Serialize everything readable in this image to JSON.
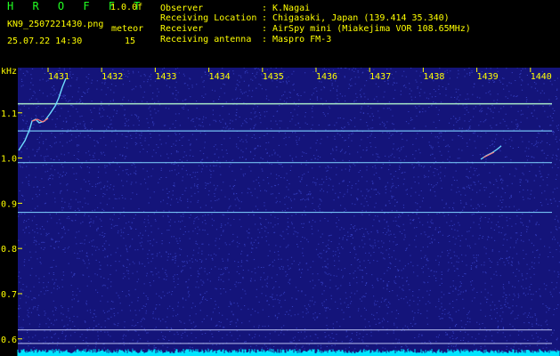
{
  "header": {
    "app_title": "H R O F F T",
    "version": "1.0.0f",
    "filename": "KN9_2507221430.png",
    "meteo_label": "meteor",
    "timestamp": "25.07.22 14:30",
    "meteo_count": "15"
  },
  "info": [
    {
      "label": "Observer",
      "value": "K.Nagai"
    },
    {
      "label": "Receiving Location",
      "value": "Chigasaki, Japan (139.414 35.340)"
    },
    {
      "label": "Receiver",
      "value": "AirSpy mini (Miakejima VOR 108.65MHz)"
    },
    {
      "label": "Receiving antenna",
      "value": "Maspro FM-3"
    }
  ],
  "spectrogram": {
    "unit_label": "kHz",
    "time_labels": [
      "1431",
      "1432",
      "1433",
      "1434",
      "1435",
      "1436",
      "1437",
      "1438",
      "1439",
      "1440"
    ],
    "freq_labels": [
      "1.1",
      "1.0",
      "0.9",
      "0.8",
      "0.7",
      "0.6"
    ],
    "freq_values": [
      1.1,
      1.0,
      0.9,
      0.8,
      0.7,
      0.6
    ],
    "carriers_khz": [
      1.12,
      1.06,
      0.99,
      0.88,
      0.62,
      0.59
    ],
    "colors": {
      "background": "#14147a",
      "noise": "#4b5cf0",
      "carrier": "#7fd3ff",
      "label": "#ffff00",
      "floor": "#00e5ff"
    }
  }
}
